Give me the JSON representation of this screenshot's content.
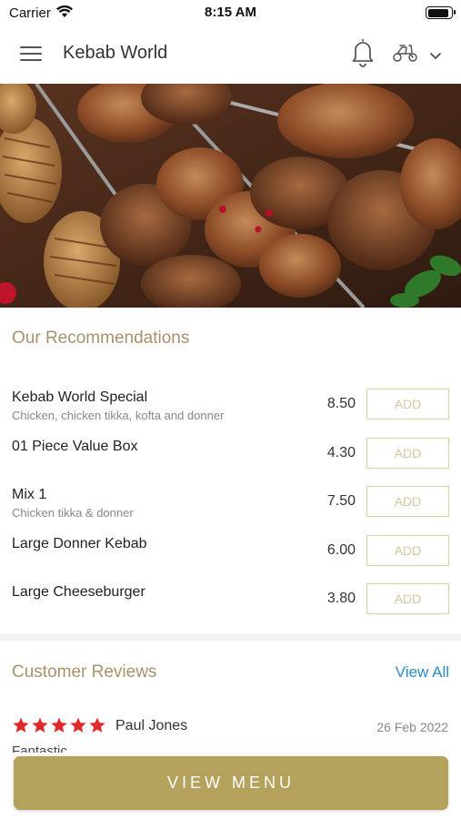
{
  "status_bar": {
    "carrier": "Carrier",
    "time": "8:15 AM",
    "battery_level": 0.9
  },
  "header": {
    "title": "Kebab World",
    "icons": [
      "menu-icon",
      "bell-icon",
      "scooter-icon",
      "chevron-down-icon"
    ]
  },
  "hero": {
    "image": "grilled kebab skewers, meats and potatoes"
  },
  "recommendations": {
    "title": "Our Recommendations",
    "add_label": "ADD",
    "items": [
      {
        "name": "Kebab World Special",
        "description": "Chicken, chicken tikka, kofta and donner",
        "price": "8.50"
      },
      {
        "name": "01 Piece Value Box",
        "description": "",
        "price": "4.30"
      },
      {
        "name": "Mix 1",
        "description": "Chicken tikka & donner",
        "price": "7.50"
      },
      {
        "name": "Large Donner Kebab",
        "description": "",
        "price": "6.00"
      },
      {
        "name": "Large Cheeseburger",
        "description": "",
        "price": "3.80"
      }
    ]
  },
  "reviews": {
    "title": "Customer Reviews",
    "view_all": "View All",
    "items": [
      {
        "rating": 5,
        "name": "Paul Jones",
        "date": "26 Feb 2022",
        "text": "Fantastic"
      }
    ]
  },
  "cta": {
    "label": "VIEW MENU"
  },
  "colors": {
    "accent_gold": "#b4a25c",
    "section_title": "#a8926a",
    "link_blue": "#2a8bc7",
    "star_red": "#e02a2a"
  }
}
